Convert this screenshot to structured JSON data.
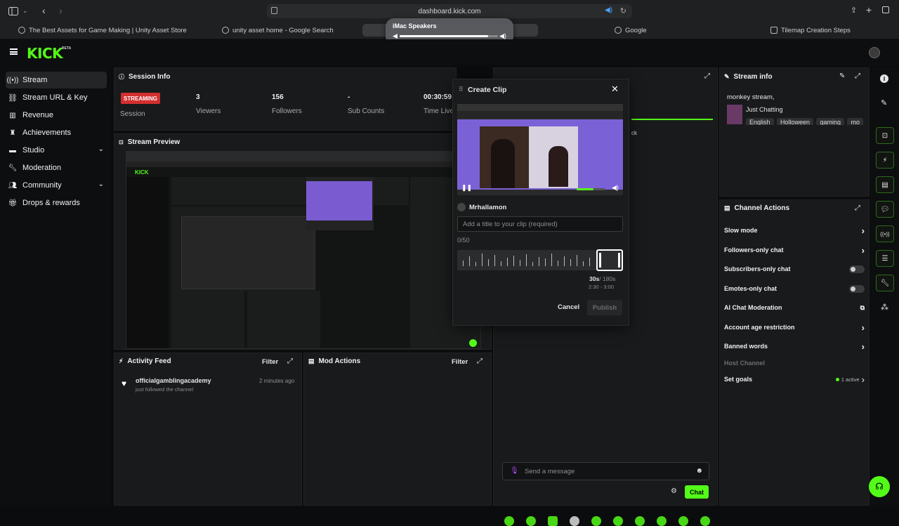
{
  "browser": {
    "url": "dashboard.kick.com",
    "tabs": [
      "The Best Assets for Game Making | Unity Asset Store",
      "unity asset home - Google Search",
      "Google",
      "Tilemap Creation Steps"
    ],
    "volume_popup": {
      "title": "iMac Speakers",
      "level": 0.9
    }
  },
  "app": {
    "logo": "KICK",
    "logo_badge": "BETA"
  },
  "sidebar": {
    "items": [
      {
        "label": "Stream",
        "icon": "stream-icon"
      },
      {
        "label": "Stream URL & Key",
        "icon": "link-icon"
      },
      {
        "label": "Revenue",
        "icon": "bar-chart-icon"
      },
      {
        "label": "Achievements",
        "icon": "trophy-icon"
      },
      {
        "label": "Studio",
        "icon": "studio-icon"
      },
      {
        "label": "Moderation",
        "icon": "wrench-icon"
      },
      {
        "label": "Community",
        "icon": "people-icon"
      },
      {
        "label": "Drops & rewards",
        "icon": "gift-icon"
      }
    ]
  },
  "session": {
    "title": "Session Info",
    "status": "STREAMING",
    "stats": [
      {
        "value": "",
        "label": "Session"
      },
      {
        "value": "3",
        "label": "Viewers"
      },
      {
        "value": "156",
        "label": "Followers"
      },
      {
        "value": "-",
        "label": "Sub Counts"
      },
      {
        "value": "00:30:59",
        "label": "Time Live"
      }
    ]
  },
  "preview": {
    "title": "Stream Preview"
  },
  "activity": {
    "title": "Activity Feed",
    "filter": "Filter",
    "items": [
      {
        "user": "officialgamblingacademy",
        "action": "just followed the channel",
        "time": "2 minutes ago"
      }
    ]
  },
  "mod_actions": {
    "title": "Mod Actions",
    "filter": "Filter"
  },
  "clip": {
    "title": "Create Clip",
    "streamer": "Mrhallamon",
    "title_placeholder": "Add a title to your clip (required)",
    "char_count": "0/50",
    "duration": "30s",
    "max_duration": "/ 180s",
    "range": "2:30 - 3:00",
    "cancel": "Cancel",
    "publish": "Publish",
    "partial_text": "ck"
  },
  "chat": {
    "placeholder": "Send a message",
    "button": "Chat"
  },
  "stream_info": {
    "title": "Stream info",
    "stream_title": "monkey stream,",
    "category": "Just Chatting",
    "tags": [
      "English",
      "Holloween",
      "gaming",
      "mo"
    ]
  },
  "channel_actions": {
    "title": "Channel Actions",
    "items": [
      {
        "label": "Slow mode",
        "control": "chevron"
      },
      {
        "label": "Followers-only chat",
        "control": "chevron"
      },
      {
        "label": "Subscribers-only chat",
        "control": "toggle"
      },
      {
        "label": "Emotes-only chat",
        "control": "toggle"
      },
      {
        "label": "AI Chat Moderation",
        "control": "external"
      },
      {
        "label": "Account age restriction",
        "control": "chevron"
      },
      {
        "label": "Banned words",
        "control": "chevron"
      },
      {
        "label": "Host Channel",
        "control": "none"
      },
      {
        "label": "Set goals",
        "control": "chevron",
        "badge": "1 active"
      }
    ]
  },
  "colors": {
    "accent": "#53fc18",
    "streaming_badge": "#d32f2f",
    "panel": "#191a1b",
    "background": "#0b0c0d"
  }
}
